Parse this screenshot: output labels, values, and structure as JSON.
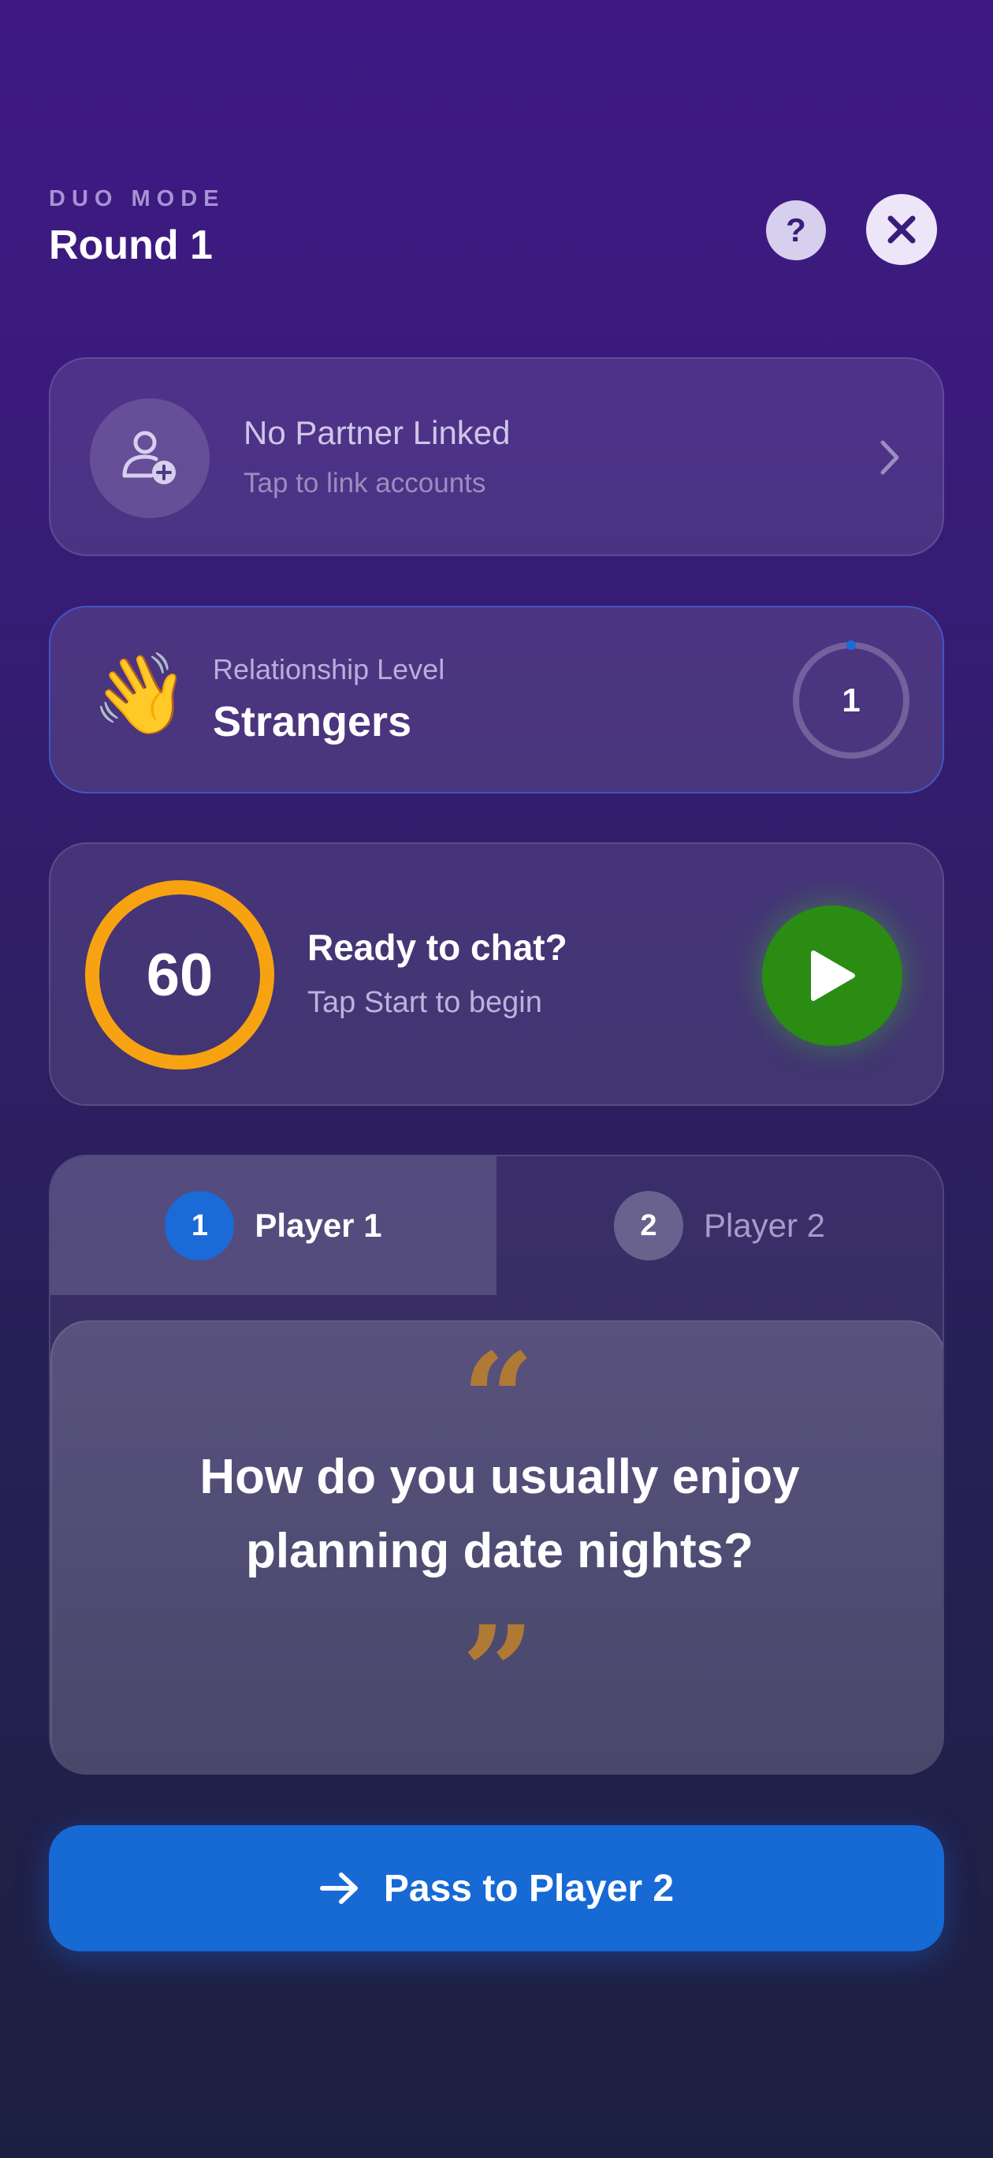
{
  "header": {
    "mode_label": "DUO MODE",
    "round_title": "Round 1",
    "help_label": "?"
  },
  "partner": {
    "title": "No Partner Linked",
    "subtitle": "Tap to link accounts"
  },
  "relationship": {
    "emoji": "👋",
    "label": "Relationship Level",
    "name": "Strangers",
    "level": "1"
  },
  "timer": {
    "value": "60",
    "title": "Ready to chat?",
    "subtitle": "Tap Start to begin"
  },
  "players": {
    "tabs": [
      {
        "number": "1",
        "label": "Player 1",
        "active": true
      },
      {
        "number": "2",
        "label": "Player 2",
        "active": false
      }
    ]
  },
  "question": {
    "open_quote": "“",
    "text": "How do you usually enjoy planning date nights?",
    "close_quote": "”"
  },
  "footer": {
    "pass_label": "Pass to Player 2"
  },
  "colors": {
    "accent_blue": "#1769d4",
    "timer_orange": "#f7a311",
    "play_green": "#2a8c12",
    "quote_gold": "#b07a35"
  }
}
